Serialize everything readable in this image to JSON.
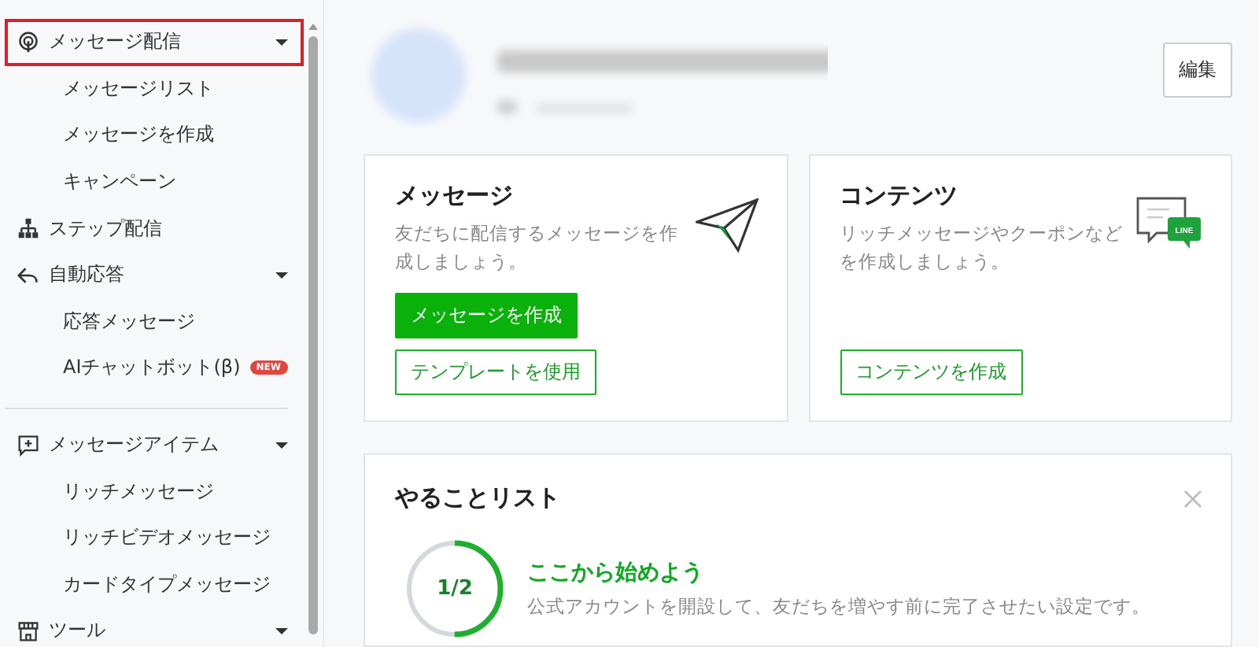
{
  "sidebar": {
    "items": [
      {
        "kind": "group",
        "label": "メッセージ配信",
        "selected": true,
        "expanded": true,
        "children": [
          {
            "label": "メッセージリスト",
            "selected": false
          },
          {
            "label": "メッセージを作成",
            "selected": false
          },
          {
            "label": "キャンペーン",
            "selected": false
          }
        ]
      },
      {
        "kind": "single",
        "label": "ステップ配信",
        "selected": false
      },
      {
        "kind": "group",
        "label": "自動応答",
        "selected": false,
        "expanded": true,
        "children": [
          {
            "label": "応答メッセージ",
            "selected": false
          },
          {
            "label": "AIチャットボット(β)",
            "badge": "NEW",
            "selected": false
          }
        ]
      },
      {
        "kind": "divider"
      },
      {
        "kind": "group",
        "label": "メッセージアイテム",
        "selected": false,
        "expanded": true,
        "children": [
          {
            "label": "リッチメッセージ",
            "selected": false
          },
          {
            "label": "リッチビデオメッセージ",
            "selected": false
          },
          {
            "label": "カードタイプメッセージ",
            "selected": false
          }
        ]
      },
      {
        "kind": "group",
        "label": "ツール",
        "selected": false,
        "expanded": true
      }
    ]
  },
  "header": {
    "edit_button": "編集"
  },
  "cards": [
    {
      "kind": "message",
      "title": "メッセージ",
      "description": "友だちに配信するメッセージを作成しましょう。",
      "buttons": [
        {
          "label": "メッセージを作成",
          "primary": true
        },
        {
          "label": "テンプレートを使用",
          "primary": false
        }
      ]
    },
    {
      "kind": "content",
      "title": "コンテンツ",
      "description": "リッチメッセージやクーポンなどを作成しましょう。",
      "badge_text": "LINE",
      "buttons": [
        {
          "label": "コンテンツを作成",
          "primary": false
        }
      ]
    }
  ],
  "todo": {
    "title": "やることリスト",
    "progress": {
      "text": "1/2",
      "level": 0.5
    },
    "heading": "ここから始めよう",
    "description": "公式アカウントを開設して、友だちを増やす前に完了させたい設定です。"
  }
}
